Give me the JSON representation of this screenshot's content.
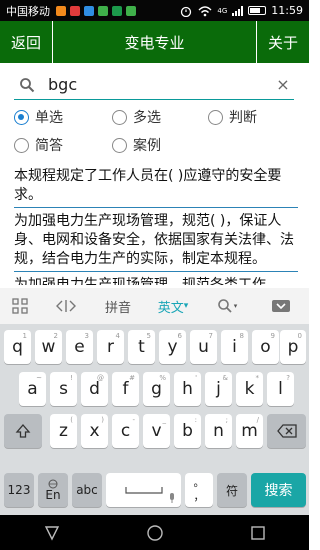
{
  "status": {
    "carrier": "中国移动",
    "network": "4G",
    "time": "11:59"
  },
  "titlebar": {
    "back": "返回",
    "title": "变电专业",
    "about": "关于"
  },
  "search": {
    "query": "bgc",
    "clear": "×"
  },
  "radios": {
    "single": "单选",
    "multi": "多选",
    "judge": "判断",
    "short": "简答",
    "case": "案例",
    "selected": "单选"
  },
  "results": [
    "本规程规定了工作人员在(    )应遵守的安全要求。",
    "为加强电力生产现场管理，规范(    )，保证人身、电网和设备安全，依据国家有关法律、法规，结合电力生产的实际，制定本规程。",
    "为加强电力生产现场管理，规范各类工作"
  ],
  "keyboard": {
    "toolbar": {
      "pinyin": "拼音",
      "english": "英文",
      "english_arrow": "▾"
    },
    "row1": [
      "q",
      "w",
      "e",
      "r",
      "t",
      "y",
      "u",
      "i",
      "o",
      "p"
    ],
    "row1_hints": [
      "1",
      "2",
      "3",
      "4",
      "5",
      "6",
      "7",
      "8",
      "9",
      "0"
    ],
    "row2": [
      "a",
      "s",
      "d",
      "f",
      "g",
      "h",
      "j",
      "k",
      "l"
    ],
    "row2_hints": [
      "~",
      "!",
      "@",
      "#",
      "%",
      "'",
      "&",
      "*",
      "?"
    ],
    "row3": [
      "z",
      "x",
      "c",
      "v",
      "b",
      "n",
      "m"
    ],
    "row3_hints": [
      "(",
      ")",
      "-",
      "_",
      ":",
      ";",
      "/"
    ],
    "num": "123",
    "lang": "En",
    "abc": "abc",
    "comma": "，",
    "period": "。",
    "fu": "符",
    "search": "搜索"
  }
}
